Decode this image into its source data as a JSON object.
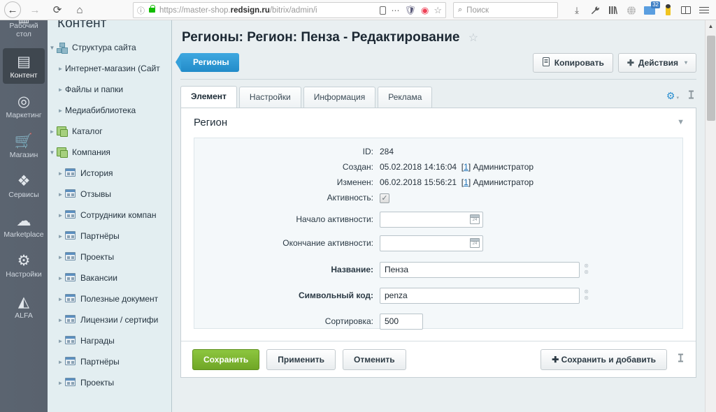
{
  "browser": {
    "nav": {
      "back": "←",
      "forward": "→",
      "reload": "⟳",
      "home": "⌂"
    },
    "url": {
      "prefix": "https://master-shop.",
      "domain": "redsign.ru",
      "path": "/bitrix/admin/i"
    },
    "url_icons": {
      "info": "ⓘ",
      "lock": "lock",
      "reader": "reader",
      "menu_dots": "⋯",
      "shield": "🛡",
      "pocket": "◉",
      "star": "☆"
    },
    "search": {
      "placeholder": "Поиск",
      "glyph": "⌕"
    },
    "toolbar_icons": [
      {
        "name": "downloads-icon",
        "glyph": "⤓"
      },
      {
        "name": "wrench-icon",
        "glyph": "🔧"
      },
      {
        "name": "library-icon",
        "glyph": "|||\\"
      },
      {
        "name": "globe-icon",
        "glyph": "🌐"
      },
      {
        "name": "mail-icon",
        "badge": "32"
      },
      {
        "name": "person-icon",
        "glyph": ""
      },
      {
        "name": "sidebar-icon",
        "glyph": ""
      },
      {
        "name": "menu-icon",
        "glyph": "≡"
      }
    ]
  },
  "rail": {
    "items": [
      {
        "label": "Рабочий стол",
        "glyph": "▤",
        "active": false
      },
      {
        "label": "Контент",
        "glyph": "▤",
        "active": true
      },
      {
        "label": "Маркетинг",
        "glyph": "◎",
        "active": false
      },
      {
        "label": "Магазин",
        "glyph": "🛒",
        "active": false
      },
      {
        "label": "Сервисы",
        "glyph": "◆",
        "active": false
      },
      {
        "label": "Marketplace",
        "glyph": "☁",
        "active": false
      },
      {
        "label": "Настройки",
        "glyph": "⚙",
        "active": false
      },
      {
        "label": "ALFA",
        "glyph": "◬",
        "active": false
      }
    ]
  },
  "tree": {
    "title": "Контент",
    "items": [
      {
        "label": "Структура сайта",
        "icon": "struct",
        "indent": 0,
        "arrow": "▼"
      },
      {
        "label": "Интернет-магазин (Сайт",
        "icon": "none",
        "indent": 1,
        "arrow": "►"
      },
      {
        "label": "Файлы и папки",
        "icon": "none",
        "indent": 1,
        "arrow": "►"
      },
      {
        "label": "Медиабиблиотека",
        "icon": "none",
        "indent": 1,
        "arrow": "►"
      },
      {
        "label": "Каталог",
        "icon": "iblock",
        "indent": 0,
        "arrow": "►"
      },
      {
        "label": "Компания",
        "icon": "iblock",
        "indent": 0,
        "arrow": "▼"
      },
      {
        "label": "История",
        "icon": "section",
        "indent": 1,
        "arrow": "►"
      },
      {
        "label": "Отзывы",
        "icon": "section",
        "indent": 1,
        "arrow": "►"
      },
      {
        "label": "Сотрудники компан",
        "icon": "section",
        "indent": 1,
        "arrow": "►"
      },
      {
        "label": "Партнёры",
        "icon": "section",
        "indent": 1,
        "arrow": "►"
      },
      {
        "label": "Проекты",
        "icon": "section",
        "indent": 1,
        "arrow": "►"
      },
      {
        "label": "Вакансии",
        "icon": "section",
        "indent": 1,
        "arrow": "►"
      },
      {
        "label": "Полезные документ",
        "icon": "section",
        "indent": 1,
        "arrow": "►"
      },
      {
        "label": "Лицензии / сертифи",
        "icon": "section",
        "indent": 1,
        "arrow": "►"
      },
      {
        "label": "Награды",
        "icon": "section",
        "indent": 1,
        "arrow": "►"
      },
      {
        "label": "Партнёры",
        "icon": "section",
        "indent": 1,
        "arrow": "►"
      },
      {
        "label": "Проекты",
        "icon": "section",
        "indent": 1,
        "arrow": "►"
      }
    ]
  },
  "page": {
    "title": "Регионы: Регион: Пенза - Редактирование",
    "star": "☆",
    "breadcrumb_chip": "Регионы",
    "toolbar_buttons": [
      {
        "label": "Копировать",
        "glyph": "⧉",
        "caret": false
      },
      {
        "label": "Действия",
        "glyph": "✚",
        "caret": true
      }
    ],
    "caret_glyph": "▾"
  },
  "tabs": {
    "items": [
      {
        "label": "Элемент",
        "active": true
      },
      {
        "label": "Настройки",
        "active": false
      },
      {
        "label": "Информация",
        "active": false
      },
      {
        "label": "Реклама",
        "active": false
      }
    ],
    "gear": "⚙",
    "gear_caret": "▾",
    "pin": "📌"
  },
  "form": {
    "section_title": "Регион",
    "collapse_caret": "▼",
    "fields": {
      "id": {
        "label": "ID:",
        "value": "284"
      },
      "created": {
        "label": "Создан:",
        "datetime": "05.02.2018 14:16:04",
        "user_link": "1",
        "user_name": "Администратор"
      },
      "modified": {
        "label": "Изменен:",
        "datetime": "06.02.2018 15:56:21",
        "user_link": "1",
        "user_name": "Администратор"
      },
      "active": {
        "label": "Активность:",
        "checked": true,
        "check_glyph": "✓"
      },
      "active_from": {
        "label": "Начало активности:",
        "value": ""
      },
      "active_to": {
        "label": "Окончание активности:",
        "value": ""
      },
      "name": {
        "label": "Название:",
        "value": "Пенза"
      },
      "code": {
        "label": "Символьный код:",
        "value": "penza"
      },
      "sort": {
        "label": "Сортировка:",
        "value": "500"
      }
    }
  },
  "footer": {
    "save": "Сохранить",
    "apply": "Применить",
    "cancel": "Отменить",
    "save_and_add": "Сохранить и добавить",
    "save_and_add_glyph": "✚",
    "pin": "📌"
  },
  "scrollbar": {
    "up_arrow": "▲"
  },
  "colors": {
    "accent_blue": "#2b8fd0",
    "save_green": "#8dc63f",
    "chip_blue": "#3fa8e0",
    "rail_bg": "#5b6470",
    "tree_bg": "#e3eef1",
    "main_bg": "#e9eff1"
  }
}
